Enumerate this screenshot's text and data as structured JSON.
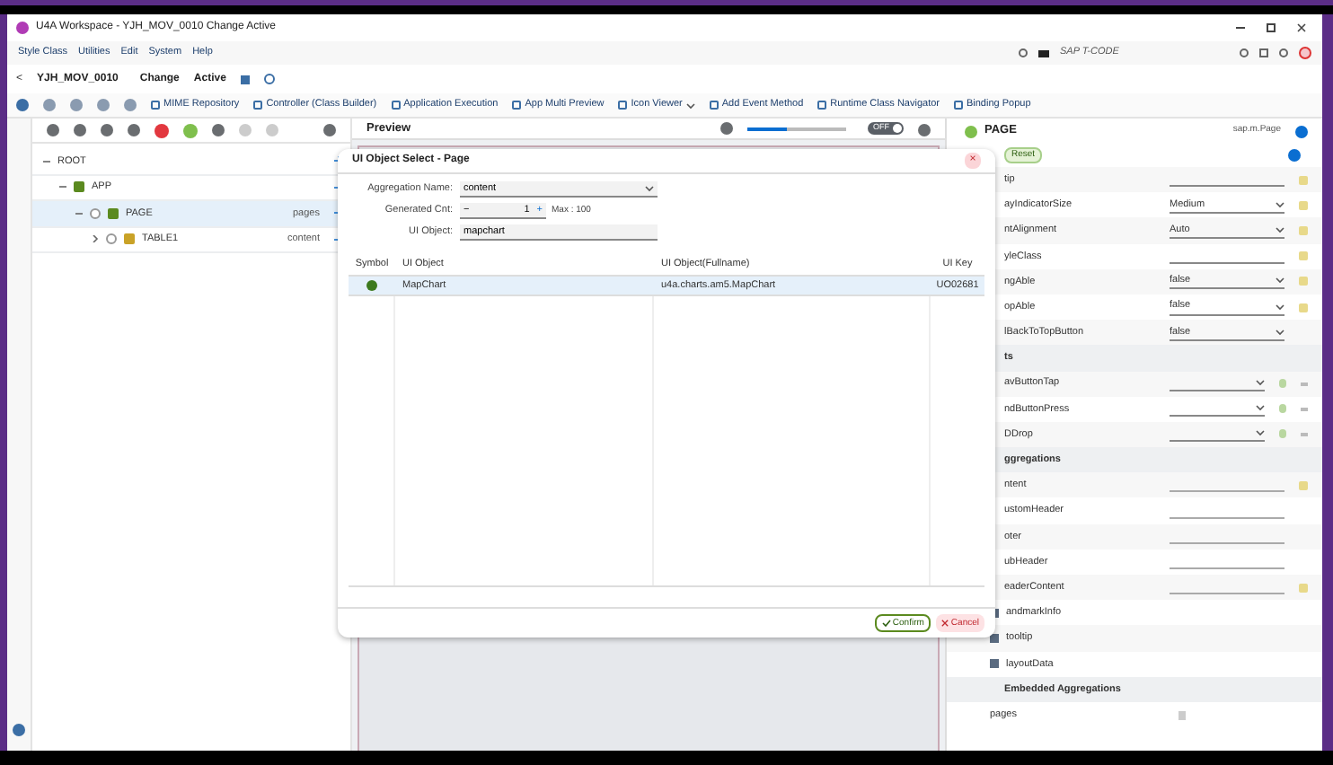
{
  "window": {
    "title": "U4A Workspace - YJH_MOV_0010 Change Active"
  },
  "menu": [
    "Style Class",
    "Utilities",
    "Edit",
    "System",
    "Help"
  ],
  "tcode": {
    "placeholder": "SAP T-CODE"
  },
  "header": {
    "back": "<",
    "app_id": "YJH_MOV_0010",
    "mode": "Change",
    "status": "Active"
  },
  "toolbar": [
    {
      "label": "MIME Repository",
      "dropdown": false
    },
    {
      "label": "Controller (Class Builder)",
      "dropdown": false
    },
    {
      "label": "Application Execution",
      "dropdown": false
    },
    {
      "label": "App Multi Preview",
      "dropdown": false
    },
    {
      "label": "Icon Viewer",
      "dropdown": true
    },
    {
      "label": "Add Event Method",
      "dropdown": false
    },
    {
      "label": "Runtime Class Navigator",
      "dropdown": false
    },
    {
      "label": "Binding Popup",
      "dropdown": false
    }
  ],
  "tree": [
    {
      "label": "ROOT",
      "kind": "root",
      "selected": false,
      "expanded": true,
      "children": [
        {
          "label": "APP",
          "kind": "app",
          "selected": false,
          "expanded": true,
          "children": [
            {
              "label": "PAGE",
              "kind": "page",
              "badge": "pages",
              "selected": true,
              "expanded": true,
              "children": [
                {
                  "label": "TABLE1",
                  "kind": "table",
                  "badge": "content",
                  "selected": false,
                  "expanded": false
                }
              ]
            }
          ]
        }
      ]
    }
  ],
  "preview": {
    "title": "Preview",
    "level": 0.4,
    "toggle": "OFF",
    "on": false
  },
  "dialog": {
    "title": "UI Object Select - Page",
    "close": "×",
    "aggregation": {
      "label": "Aggregation Name:",
      "value": "content"
    },
    "count": {
      "label": "Generated Cnt:",
      "minus": "−",
      "value": "1",
      "plus": "+",
      "max": "Max : 100"
    },
    "object": {
      "label": "UI Object:",
      "value": "mapchart"
    },
    "columns": [
      "Symbol",
      "UI Object",
      "UI Object(Fullname)",
      "UI Key"
    ],
    "rows": [
      {
        "name": "MapChart",
        "fullname": "u4a.charts.am5.MapChart",
        "key": "UO02681",
        "selected": true
      }
    ],
    "confirm": "Confirm",
    "cancel": "Cancel"
  },
  "properties": {
    "title": "PAGE",
    "class": "sap.m.Page",
    "reset": "Reset",
    "rows": [
      {
        "kind": "field",
        "label": "tip",
        "value": "",
        "binding": true
      },
      {
        "kind": "select",
        "label": "ayIndicatorSize",
        "value": "Medium",
        "binding": true
      },
      {
        "kind": "select",
        "label": "ntAlignment",
        "value": "Auto",
        "binding": true
      },
      {
        "kind": "field",
        "label": "yleClass",
        "value": "",
        "binding": true
      },
      {
        "kind": "select",
        "label": "ngAble",
        "value": "false",
        "binding": true
      },
      {
        "kind": "select",
        "label": "opAble",
        "value": "false",
        "binding": true
      },
      {
        "kind": "select",
        "label": "lBackToTopButton",
        "value": "false",
        "binding": false
      },
      {
        "kind": "section",
        "label": "ts"
      },
      {
        "kind": "event",
        "label": "avButtonTap"
      },
      {
        "kind": "event",
        "label": "ndButtonPress"
      },
      {
        "kind": "event",
        "label": "DDrop"
      },
      {
        "kind": "section",
        "label": "ggregations"
      },
      {
        "kind": "aggregation",
        "label": "ntent",
        "binding": true
      },
      {
        "kind": "aggregation",
        "label": "ustomHeader",
        "binding": false
      },
      {
        "kind": "aggregation",
        "label": "oter",
        "binding": false
      },
      {
        "kind": "aggregation",
        "label": "ubHeader",
        "binding": false
      },
      {
        "kind": "aggregation",
        "label": "eaderContent",
        "binding": true
      },
      {
        "kind": "check",
        "label": "andmarkInfo"
      },
      {
        "kind": "check",
        "label": "tooltip"
      },
      {
        "kind": "check",
        "label": "layoutData"
      },
      {
        "kind": "section",
        "label": "Embedded Aggregations"
      },
      {
        "kind": "embedded",
        "label": "pages"
      }
    ]
  }
}
